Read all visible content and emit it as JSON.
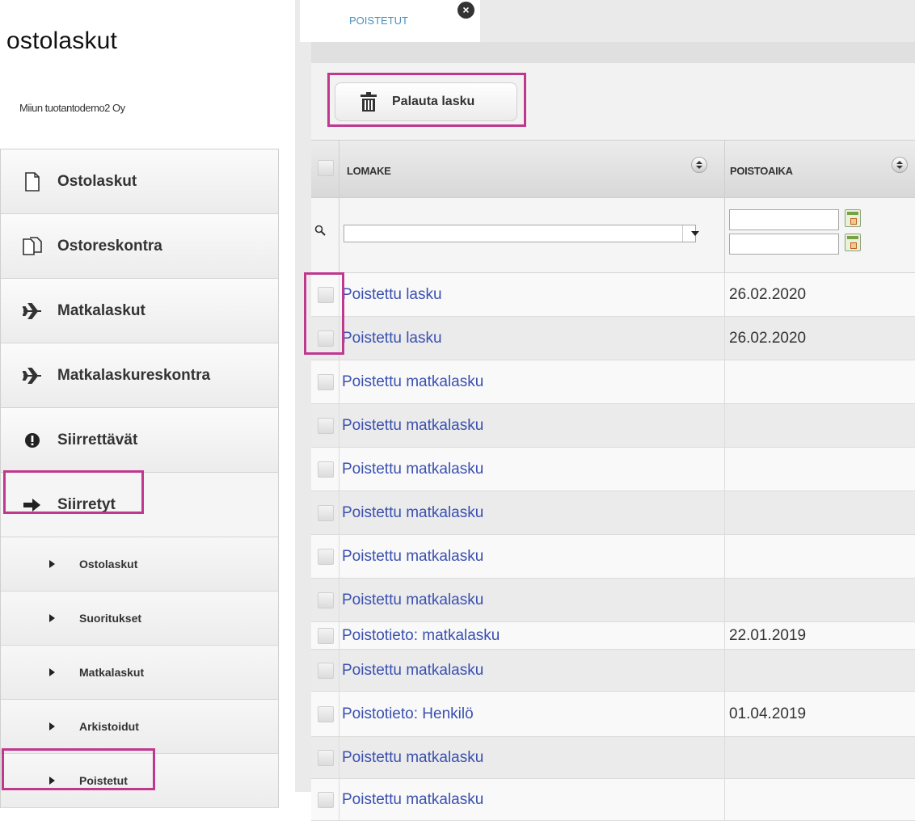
{
  "app": {
    "title": "ostolaskut",
    "company": "Miiun tuotantodemo2 Oy"
  },
  "sidebar": {
    "items": [
      {
        "label": "Ostolaskut",
        "icon": "document-icon"
      },
      {
        "label": "Ostoreskontra",
        "icon": "documents-icon"
      },
      {
        "label": "Matkalaskut",
        "icon": "airplane-icon"
      },
      {
        "label": "Matkalaskureskontra",
        "icon": "airplane-icon"
      },
      {
        "label": "Siirrettävät",
        "icon": "exclamation-icon"
      },
      {
        "label": "Siirretyt",
        "icon": "arrow-right-icon"
      }
    ],
    "subitems": [
      {
        "label": "Ostolaskut"
      },
      {
        "label": "Suoritukset"
      },
      {
        "label": "Matkalaskut"
      },
      {
        "label": "Arkistoidut"
      },
      {
        "label": "Poistetut"
      }
    ]
  },
  "tabs": [
    {
      "label": "POISTETUT",
      "close_icon": "close-icon"
    }
  ],
  "toolbar": {
    "restore_label": "Palauta lasku",
    "restore_icon": "trash-icon"
  },
  "grid": {
    "columns": [
      {
        "label": "LOMAKE"
      },
      {
        "label": "POISTOAIKA"
      }
    ],
    "filter": {
      "lomake_value": "",
      "date_from": "",
      "date_to": ""
    },
    "rows": [
      {
        "name": "Poistettu lasku",
        "date": "26.02.2020"
      },
      {
        "name": "Poistettu lasku",
        "date": "26.02.2020"
      },
      {
        "name": "Poistettu matkalasku",
        "date": ""
      },
      {
        "name": "Poistettu matkalasku",
        "date": ""
      },
      {
        "name": "Poistettu matkalasku",
        "date": ""
      },
      {
        "name": "Poistettu matkalasku",
        "date": ""
      },
      {
        "name": "Poistettu matkalasku",
        "date": ""
      },
      {
        "name": "Poistettu matkalasku",
        "date": ""
      },
      {
        "name": "Poistotieto: matkalasku",
        "date": "22.01.2019"
      },
      {
        "name": "Poistettu matkalasku",
        "date": ""
      },
      {
        "name": "Poistotieto: Henkilö",
        "date": "01.04.2019"
      },
      {
        "name": "Poistettu matkalasku",
        "date": ""
      },
      {
        "name": "Poistettu matkalasku",
        "date": ""
      }
    ]
  },
  "colors": {
    "highlight": "#c0388e",
    "link": "#3a50b0",
    "tab_text": "#4a90c0"
  }
}
